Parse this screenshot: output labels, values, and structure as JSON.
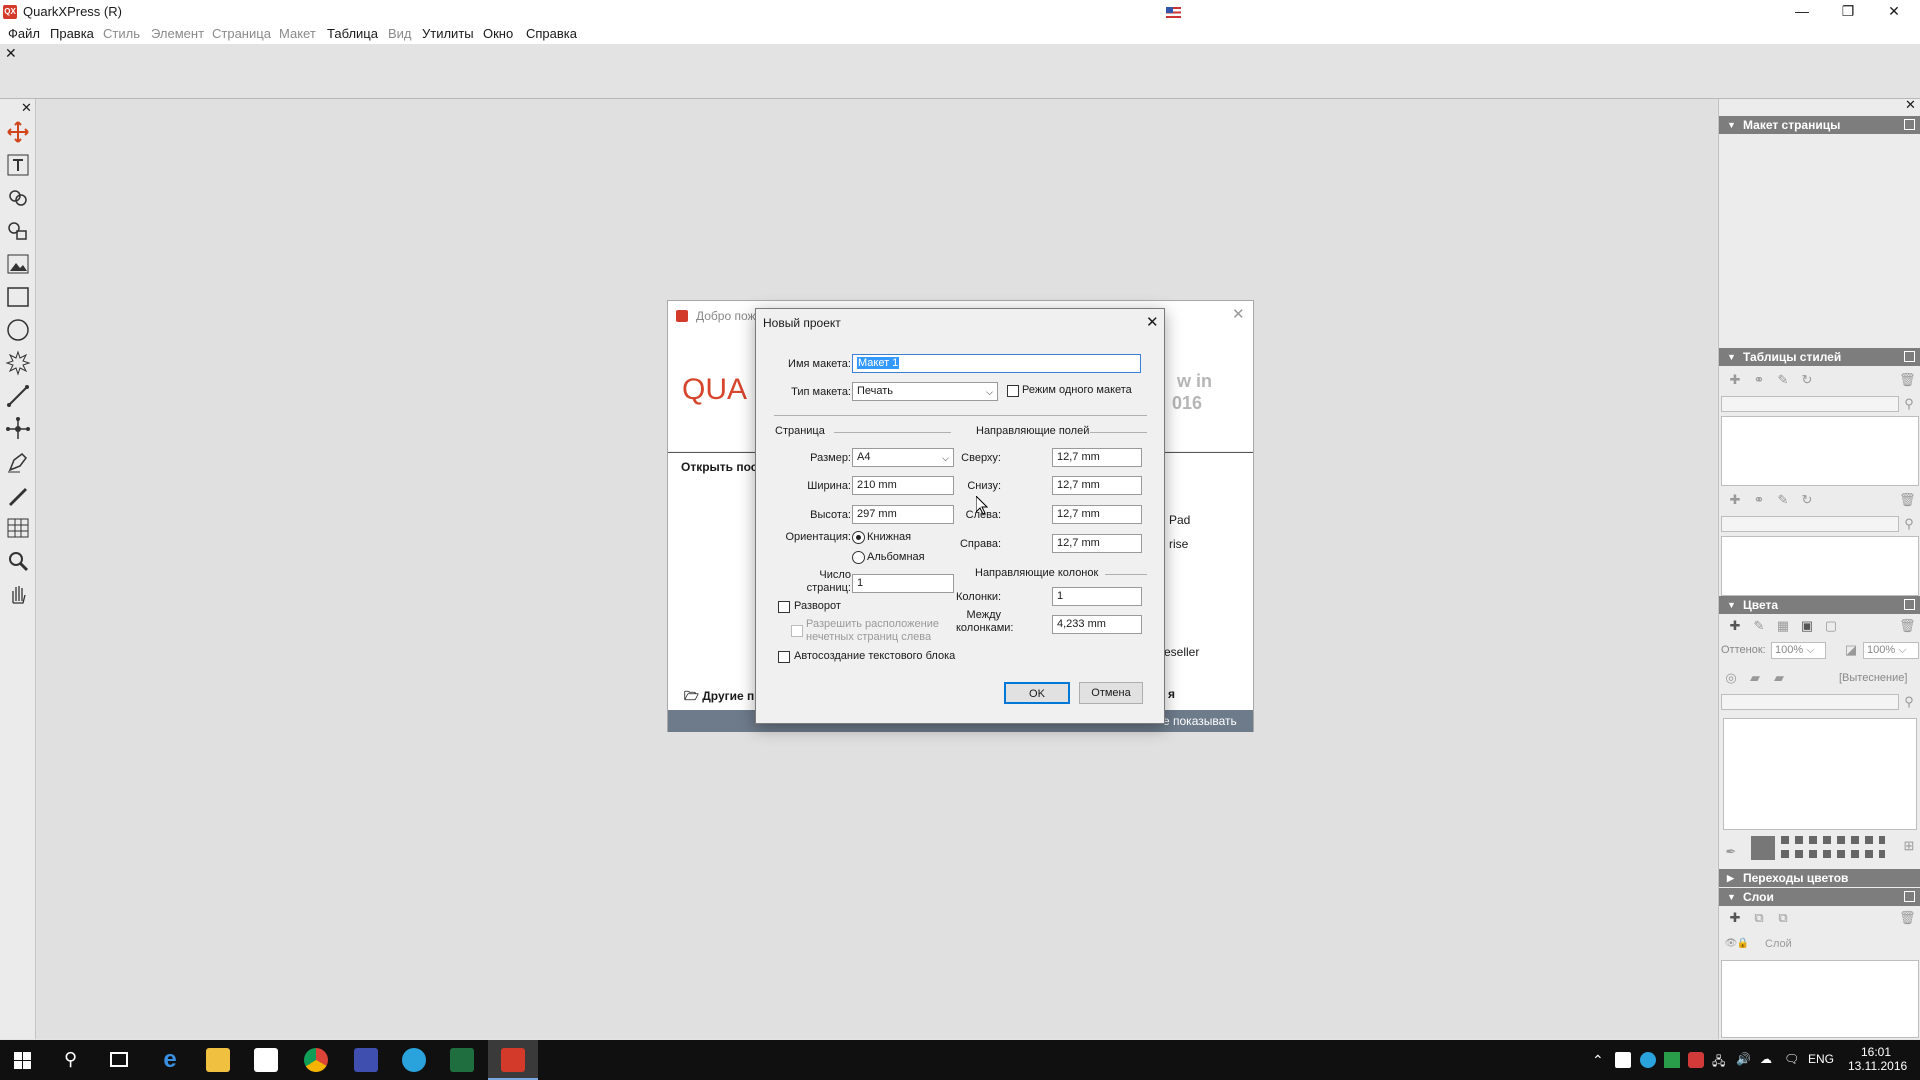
{
  "app": {
    "title": "QuarkXPress (R)",
    "icon_text": "QX",
    "window_controls": {
      "minimize": "—",
      "maximize": "❐",
      "close": "✕"
    }
  },
  "menu": [
    "Файл",
    "Правка",
    "Стиль",
    "Элемент",
    "Страница",
    "Макет",
    "Таблица",
    "Вид",
    "Утилиты",
    "Окно",
    "Справка"
  ],
  "measure_close": "✕",
  "toolbox_close": "✕",
  "tools": [
    "move-tool-icon",
    "text-tool-icon",
    "linking-tool-icon",
    "unlinking-tool-icon",
    "picture-content-icon",
    "rectangle-box-icon",
    "oval-box-icon",
    "starburst-icon",
    "line-tool-icon",
    "bezier-tool-icon",
    "pen-tool-icon",
    "freehand-icon",
    "table-tool-icon",
    "zoom-icon",
    "hand-icon"
  ],
  "panels": {
    "close": "✕",
    "page_layout": "Макет страницы",
    "style_sheets": "Таблицы стилей",
    "colors": "Цвета",
    "shade_label": "Оттенок:",
    "shade_value": "100%",
    "opacity_value": "100%",
    "knockout": "[Вытеснение]",
    "blends": "Переходы цветов",
    "layers": "Слои",
    "layer_name": "Слой"
  },
  "welcome": {
    "title": "Добро пож",
    "logo": "QUA",
    "right_text_1": "w in",
    "right_text_2": "016",
    "open_recent": "Открыть пос",
    "item_1": "Pad",
    "item_2": "rise",
    "item_3": "eseller",
    "other": "Другие п",
    "other_right": "я",
    "footer": "е показывать"
  },
  "dialog": {
    "title": "Новый проект",
    "layout_name_label": "Имя макета:",
    "layout_name_value": "Макет 1",
    "layout_type_label": "Тип макета:",
    "layout_type_value": "Печать",
    "single_layout_label": "Режим одного макета",
    "page_section": "Страница",
    "size_label": "Размер:",
    "size_value": "A4",
    "width_label": "Ширина:",
    "width_value": "210 mm",
    "height_label": "Высота:",
    "height_value": "297 mm",
    "orientation_label": "Ориентация:",
    "portrait": "Книжная",
    "landscape": "Альбомная",
    "pages_label_1": "Число",
    "pages_label_2": "страниц:",
    "pages_value": "1",
    "facing_label": "Разворот",
    "allow_left_1": "Разрешить расположение",
    "allow_left_2": "нечетных страниц слева",
    "auto_text_label": "Автосоздание текстового блока",
    "margin_section": "Направляющие полей",
    "top_label": "Сверху:",
    "top_value": "12,7 mm",
    "bottom_label": "Снизу:",
    "bottom_value": "12,7 mm",
    "left_label": "Слева:",
    "left_value": "12,7 mm",
    "right_label": "Справа:",
    "right_value": "12,7 mm",
    "column_section": "Направляющие колонок",
    "columns_label": "Колонки:",
    "columns_value": "1",
    "gutter_label_1": "Между",
    "gutter_label_2": "колонками:",
    "gutter_value": "4,233 mm",
    "ok": "OK",
    "cancel": "Отмена"
  },
  "taskbar": {
    "lang": "ENG",
    "time": "16:01",
    "date": "13.11.2016"
  }
}
